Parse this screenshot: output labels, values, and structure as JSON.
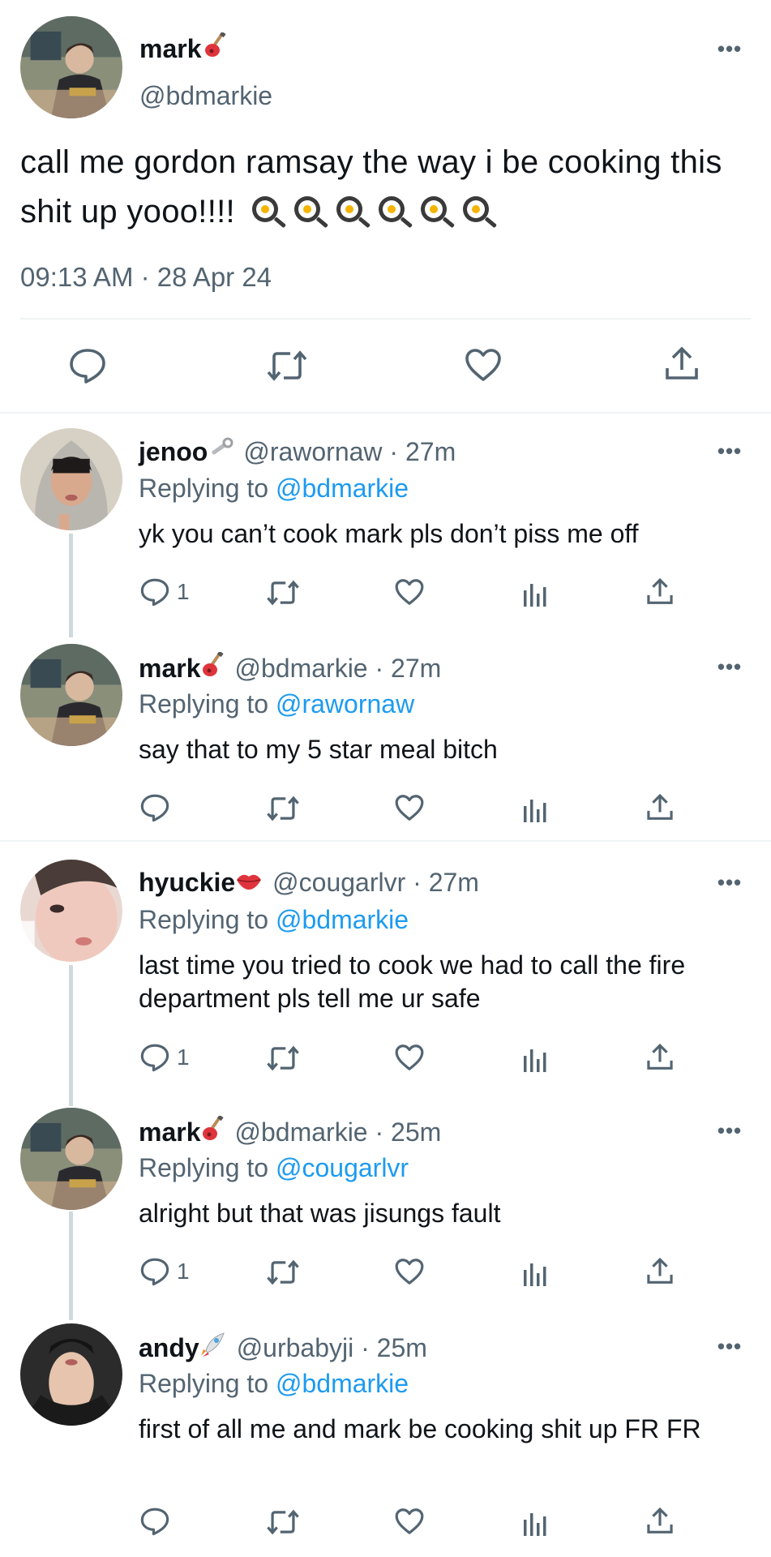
{
  "main_tweet": {
    "author_name": "mark",
    "author_emoji_icon": "guitar-icon",
    "handle": "@bdmarkie",
    "text": "call me gordon ramsay the way i be cooking this shit up yooo!!!!",
    "emoji_icons": [
      "fried-egg-pan-icon",
      "fried-egg-pan-icon",
      "fried-egg-pan-icon",
      "fried-egg-pan-icon",
      "fried-egg-pan-icon",
      "fried-egg-pan-icon"
    ],
    "timestamp": "09:13 AM · 28 Apr 24",
    "more_label": "•••"
  },
  "replies": [
    {
      "name": "jenoo",
      "name_emoji_icon": "wrench-icon",
      "meta": "@rawornaw · 27m",
      "replying_prefix": "Replying to",
      "replying_to": "@bdmarkie",
      "text": "yk you can’t cook mark pls don’t piss me off",
      "reply_count": "1"
    },
    {
      "name": "mark",
      "name_emoji_icon": "guitar-icon",
      "meta": "@bdmarkie · 27m",
      "replying_prefix": "Replying to",
      "replying_to": "@rawornaw",
      "text": "say that to my 5 star meal bitch",
      "reply_count": ""
    },
    {
      "name": "hyuckie",
      "name_emoji_icon": "kiss-lips-icon",
      "meta": "@cougarlvr · 27m",
      "replying_prefix": "Replying to",
      "replying_to": "@bdmarkie",
      "text": "last time you tried to cook we had to call the fire department pls tell me ur safe",
      "reply_count": "1"
    },
    {
      "name": "mark",
      "name_emoji_icon": "guitar-icon",
      "meta": "@bdmarkie · 25m",
      "replying_prefix": "Replying to",
      "replying_to": "@cougarlvr",
      "text": "alright but that was jisungs fault",
      "reply_count": "1"
    },
    {
      "name": "andy",
      "name_emoji_icon": "rocket-icon",
      "meta": "@urbabyji · 25m",
      "replying_prefix": "Replying to",
      "replying_to": "@bdmarkie",
      "text": "first of all me and mark be cooking shit up FR FR",
      "reply_count": ""
    }
  ],
  "colors": {
    "text": "#0f1419",
    "secondary": "#536471",
    "link": "#1d9bf0",
    "divider": "#eff3f4",
    "thread_line": "#cfd9de"
  }
}
